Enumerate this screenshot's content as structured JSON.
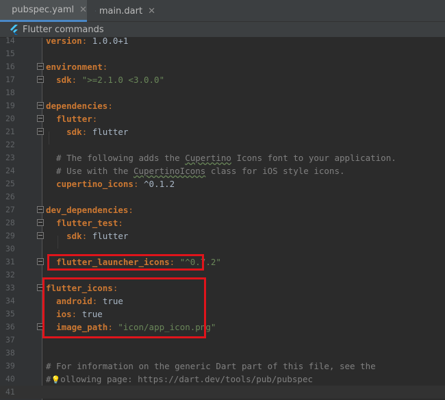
{
  "tabs": [
    {
      "label": "pubspec.yaml",
      "active": true
    },
    {
      "label": "main.dart",
      "active": false
    }
  ],
  "command_bar": {
    "label": "Flutter commands"
  },
  "code_lines": [
    {
      "no": "14",
      "parts": [
        [
          "k",
          "version"
        ],
        [
          "p",
          ": "
        ],
        [
          "v",
          "1.0.0+1"
        ]
      ]
    },
    {
      "no": "15",
      "parts": []
    },
    {
      "no": "16",
      "parts": [
        [
          "k",
          "environment"
        ],
        [
          "p",
          ":"
        ]
      ]
    },
    {
      "no": "17",
      "parts": [
        [
          "v",
          "  "
        ],
        [
          "k",
          "sdk"
        ],
        [
          "p",
          ": "
        ],
        [
          "s",
          "\">=2.1.0 <3.0.0\""
        ]
      ]
    },
    {
      "no": "18",
      "parts": []
    },
    {
      "no": "19",
      "parts": [
        [
          "k",
          "dependencies"
        ],
        [
          "p",
          ":"
        ]
      ]
    },
    {
      "no": "20",
      "parts": [
        [
          "v",
          "  "
        ],
        [
          "k",
          "flutter"
        ],
        [
          "p",
          ":"
        ]
      ]
    },
    {
      "no": "21",
      "parts": [
        [
          "v",
          "    "
        ],
        [
          "k",
          "sdk"
        ],
        [
          "p",
          ": "
        ],
        [
          "v",
          "flutter"
        ]
      ]
    },
    {
      "no": "22",
      "parts": []
    },
    {
      "no": "23",
      "parts": [
        [
          "c",
          "  # The following adds the "
        ],
        [
          "cw",
          "Cupertino"
        ],
        [
          "c",
          " Icons font to your application."
        ]
      ]
    },
    {
      "no": "24",
      "parts": [
        [
          "c",
          "  # Use with the "
        ],
        [
          "cw",
          "CupertinoIcons"
        ],
        [
          "c",
          " class for iOS style icons."
        ]
      ]
    },
    {
      "no": "25",
      "parts": [
        [
          "v",
          "  "
        ],
        [
          "k",
          "cupertino_icons"
        ],
        [
          "p",
          ": "
        ],
        [
          "v",
          "^0.1.2"
        ]
      ]
    },
    {
      "no": "26",
      "parts": []
    },
    {
      "no": "27",
      "parts": [
        [
          "k",
          "dev_dependencies"
        ],
        [
          "p",
          ":"
        ]
      ]
    },
    {
      "no": "28",
      "parts": [
        [
          "v",
          "  "
        ],
        [
          "k",
          "flutter_test"
        ],
        [
          "p",
          ":"
        ]
      ]
    },
    {
      "no": "29",
      "parts": [
        [
          "v",
          "    "
        ],
        [
          "k",
          "sdk"
        ],
        [
          "p",
          ": "
        ],
        [
          "v",
          "flutter"
        ]
      ]
    },
    {
      "no": "30",
      "parts": []
    },
    {
      "no": "31",
      "parts": [
        [
          "v",
          "  "
        ],
        [
          "k",
          "flutter_launcher_icons"
        ],
        [
          "p",
          ": "
        ],
        [
          "s",
          "\"^0.7.2\""
        ]
      ]
    },
    {
      "no": "32",
      "parts": []
    },
    {
      "no": "33",
      "parts": [
        [
          "k",
          "flutter_icons"
        ],
        [
          "p",
          ":"
        ]
      ]
    },
    {
      "no": "34",
      "parts": [
        [
          "v",
          "  "
        ],
        [
          "k",
          "android"
        ],
        [
          "p",
          ": "
        ],
        [
          "v",
          "true"
        ]
      ]
    },
    {
      "no": "35",
      "parts": [
        [
          "v",
          "  "
        ],
        [
          "k",
          "ios"
        ],
        [
          "p",
          ": "
        ],
        [
          "v",
          "true"
        ]
      ]
    },
    {
      "no": "36",
      "parts": [
        [
          "v",
          "  "
        ],
        [
          "k",
          "image_path"
        ],
        [
          "p",
          ": "
        ],
        [
          "s",
          "\"icon/app_icon.png\""
        ]
      ]
    },
    {
      "no": "37",
      "parts": []
    },
    {
      "no": "38",
      "parts": []
    },
    {
      "no": "39",
      "parts": [
        [
          "c",
          "# For information on the generic Dart part of this file, see the"
        ]
      ]
    },
    {
      "no": "40",
      "parts": [
        [
          "c",
          "#"
        ],
        [
          "bulb",
          "💡"
        ],
        [
          "c",
          "ollowing page: https://dart.dev/tools/pub/pubspec"
        ]
      ]
    },
    {
      "no": "41",
      "parts": []
    }
  ],
  "colors": {
    "highlight": "#e0141b",
    "keyword": "#cc7832",
    "string": "#6a8759",
    "comment": "#808080"
  }
}
